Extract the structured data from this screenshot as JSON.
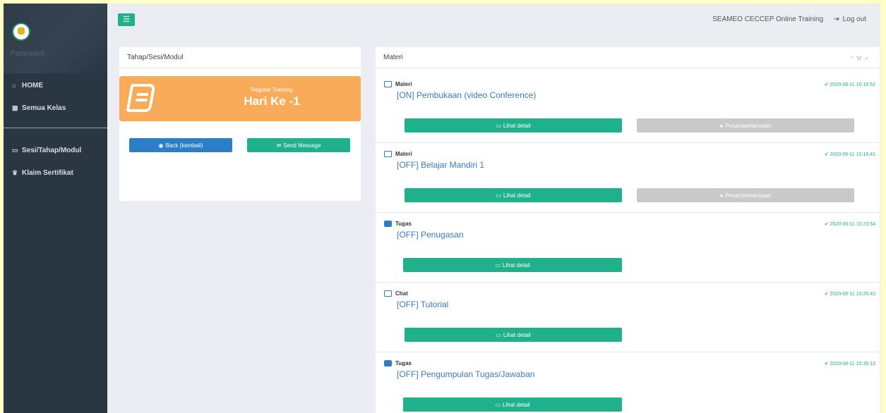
{
  "sidebar": {
    "role": "Participant",
    "items": [
      {
        "icon": "home-icon",
        "glyph": "⌂",
        "label": "HOME"
      },
      {
        "icon": "calendar-icon",
        "glyph": "▦",
        "label": "Semua Kelas"
      },
      {
        "icon": "folder-icon",
        "glyph": "▭",
        "label": "Sesi/Tahap/Modul"
      },
      {
        "icon": "trophy-icon",
        "glyph": "♛",
        "label": "Klaim Sertifikat"
      }
    ]
  },
  "topbar": {
    "org": "SEAMEO CECCEP Online Training",
    "logout": "Log out"
  },
  "left_panel": {
    "title": "Tahap/Sesi/Modul",
    "hero_sub": "Regular Training",
    "hero_main": "Hari Ke -1",
    "back_label": "Back (kembali)",
    "send_label": "Send Message"
  },
  "right_panel": {
    "title": "Materi",
    "items": [
      {
        "type": "Materi",
        "title": "[ON] Pembukaan (video Conference)",
        "time": "2020-08-11 10:16:52",
        "detail": "Lihat detail",
        "message": "Pesan/pertanyaan"
      },
      {
        "type": "Materi",
        "title": "[OFF] Belajar Mandiri 1",
        "time": "2020-08-11 10:16:41",
        "detail": "Lihat detail",
        "message": "Pesan/pertanyaan"
      },
      {
        "type": "Tugas",
        "title": "[OFF] Penugasan",
        "time": "2020-08-11 10:23:54",
        "detail": "Lihat detail"
      },
      {
        "type": "Chat",
        "title": "[OFF] Tutorial",
        "time": "2020-08-11 10:25:43",
        "detail": "Lihat detail"
      },
      {
        "type": "Tugas",
        "title": "[OFF] Pengumpulan Tugas/Jawaban",
        "time": "2020-08-11 10:30:13",
        "detail": "Lihat detail"
      }
    ]
  },
  "colors": {
    "accent": "#1fb08c",
    "primary": "#2c7fc7",
    "hero": "#f8ac59",
    "sidebar": "#2b3643"
  }
}
